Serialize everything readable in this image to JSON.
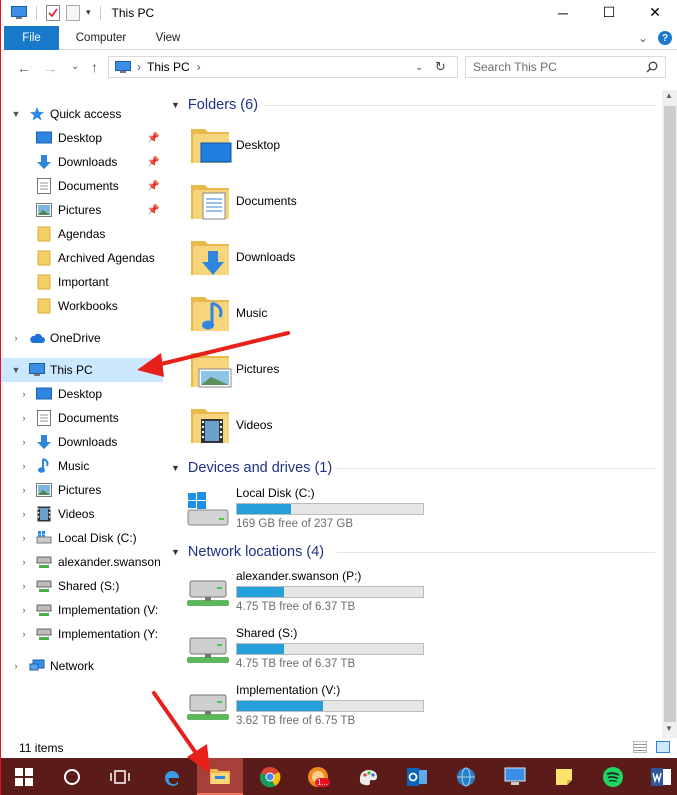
{
  "window": {
    "title": "This PC",
    "controls": {
      "minimize": "─",
      "maximize": "☐",
      "close": "✕"
    }
  },
  "ribbon": {
    "tabs": [
      {
        "label": "File"
      },
      {
        "label": "Computer"
      },
      {
        "label": "View"
      }
    ],
    "expand_glyph": "⌄",
    "help_glyph": "?"
  },
  "address": {
    "back": "←",
    "forward": "→",
    "recent": "⌄",
    "up": "↑",
    "crumb_sep": "›",
    "path": "This PC",
    "crumb_end": "›",
    "dropdown": "⌄",
    "refresh": "↻",
    "search_placeholder": "Search This PC"
  },
  "nav": {
    "quick_access": {
      "label": "Quick access",
      "items": [
        {
          "label": "Desktop",
          "icon": "desktop-icon",
          "pinned": true
        },
        {
          "label": "Downloads",
          "icon": "downloads-icon",
          "pinned": true
        },
        {
          "label": "Documents",
          "icon": "documents-icon",
          "pinned": true
        },
        {
          "label": "Pictures",
          "icon": "pictures-icon",
          "pinned": true
        },
        {
          "label": "Agendas",
          "icon": "folder-icon",
          "pinned": false
        },
        {
          "label": "Archived Agendas",
          "icon": "folder-icon",
          "pinned": false
        },
        {
          "label": "Important",
          "icon": "folder-icon",
          "pinned": false
        },
        {
          "label": "Workbooks",
          "icon": "folder-icon",
          "pinned": false
        }
      ]
    },
    "onedrive": {
      "label": "OneDrive"
    },
    "this_pc": {
      "label": "This PC",
      "items": [
        {
          "label": "Desktop",
          "icon": "desktop-icon"
        },
        {
          "label": "Documents",
          "icon": "documents-icon"
        },
        {
          "label": "Downloads",
          "icon": "downloads-icon"
        },
        {
          "label": "Music",
          "icon": "music-icon"
        },
        {
          "label": "Pictures",
          "icon": "pictures-icon"
        },
        {
          "label": "Videos",
          "icon": "videos-icon"
        },
        {
          "label": "Local Disk (C:)",
          "icon": "local-disk-icon"
        },
        {
          "label": "alexander.swanson",
          "icon": "network-drive-icon"
        },
        {
          "label": "Shared (S:)",
          "icon": "network-drive-icon"
        },
        {
          "label": "Implementation (V:",
          "icon": "network-drive-icon"
        },
        {
          "label": "Implementation (Y:",
          "icon": "network-drive-icon"
        }
      ]
    },
    "network": {
      "label": "Network"
    }
  },
  "content": {
    "folders": {
      "header": "Folders (6)",
      "items": [
        {
          "label": "Desktop"
        },
        {
          "label": "Documents"
        },
        {
          "label": "Downloads"
        },
        {
          "label": "Music"
        },
        {
          "label": "Pictures"
        },
        {
          "label": "Videos"
        }
      ]
    },
    "devices": {
      "header": "Devices and drives (1)",
      "items": [
        {
          "label": "Local Disk (C:)",
          "free": "169 GB free of 237 GB",
          "used_fraction": 0.29
        }
      ]
    },
    "network": {
      "header": "Network locations (4)",
      "items": [
        {
          "label": "alexander.swanson (P:)",
          "free": "4.75 TB free of 6.37 TB",
          "used_fraction": 0.25
        },
        {
          "label": "Shared (S:)",
          "free": "4.75 TB free of 6.37 TB",
          "used_fraction": 0.25
        },
        {
          "label": "Implementation (V:)",
          "free": "3.62 TB free of 6.75 TB",
          "used_fraction": 0.46
        }
      ]
    }
  },
  "status": {
    "items_count": "11 items"
  },
  "taskbar": {
    "apps": [
      {
        "icon": "windows-start-icon"
      },
      {
        "icon": "cortana-search-icon"
      },
      {
        "icon": "task-view-icon"
      },
      {
        "icon": "edge-icon"
      },
      {
        "icon": "file-explorer-icon",
        "active": true
      },
      {
        "icon": "chrome-icon"
      },
      {
        "icon": "notification-app-icon",
        "badge": "1..."
      },
      {
        "icon": "paint-icon"
      },
      {
        "icon": "outlook-icon"
      },
      {
        "icon": "network-globe-icon"
      },
      {
        "icon": "remote-desktop-icon"
      },
      {
        "icon": "sticky-notes-icon"
      },
      {
        "icon": "spotify-icon"
      },
      {
        "icon": "word-icon"
      }
    ]
  },
  "colors": {
    "accent": "#1979ca",
    "selection": "#cce8ff",
    "header_text": "#1e3287",
    "bar_fill": "#26a0da",
    "taskbar": "#5b1b18",
    "annotation_arrow": "#e8201a"
  }
}
